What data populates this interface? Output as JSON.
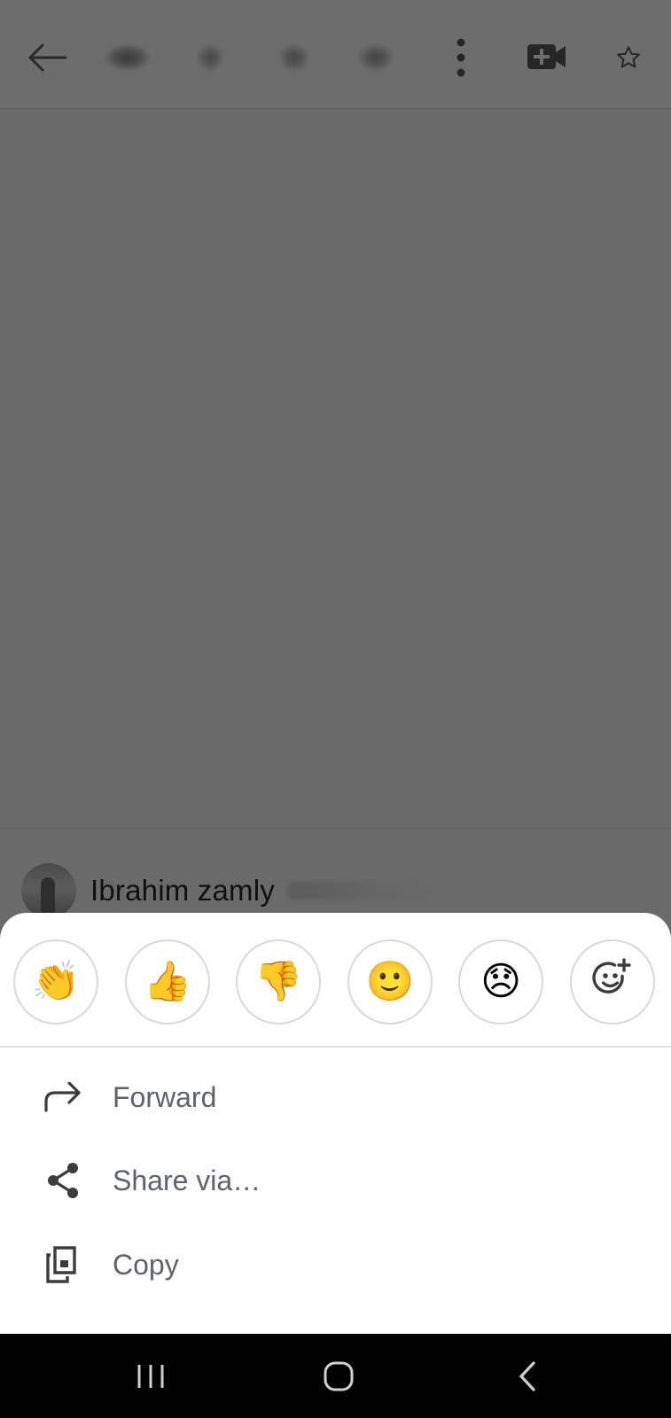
{
  "topbar": {
    "back_icon": "arrow-back-icon",
    "more_icon": "more-vert-icon",
    "video_icon": "video-add-icon",
    "star_icon": "star-outline-icon"
  },
  "message": {
    "sender_name": "Ibrahim zamly"
  },
  "reactions": [
    {
      "emoji": "👏",
      "name": "clapping-hands"
    },
    {
      "emoji": "👍",
      "name": "thumbs-up"
    },
    {
      "emoji": "👎",
      "name": "thumbs-down"
    },
    {
      "emoji": "🙂",
      "name": "slightly-smiling-face"
    },
    {
      "emoji": "😞",
      "name": "disappointed-face"
    }
  ],
  "add_reaction_icon": "add-emoji-icon",
  "menu": {
    "forward_label": "Forward",
    "share_label": "Share via…",
    "copy_label": "Copy"
  },
  "navbar": {
    "recents_icon": "recents-icon",
    "home_icon": "home-icon",
    "back_icon": "nav-back-icon"
  },
  "colors": {
    "scrim": "#6a6a6a",
    "sheet": "#ffffff",
    "menu_text": "#5f6368",
    "navbar": "#000000"
  }
}
